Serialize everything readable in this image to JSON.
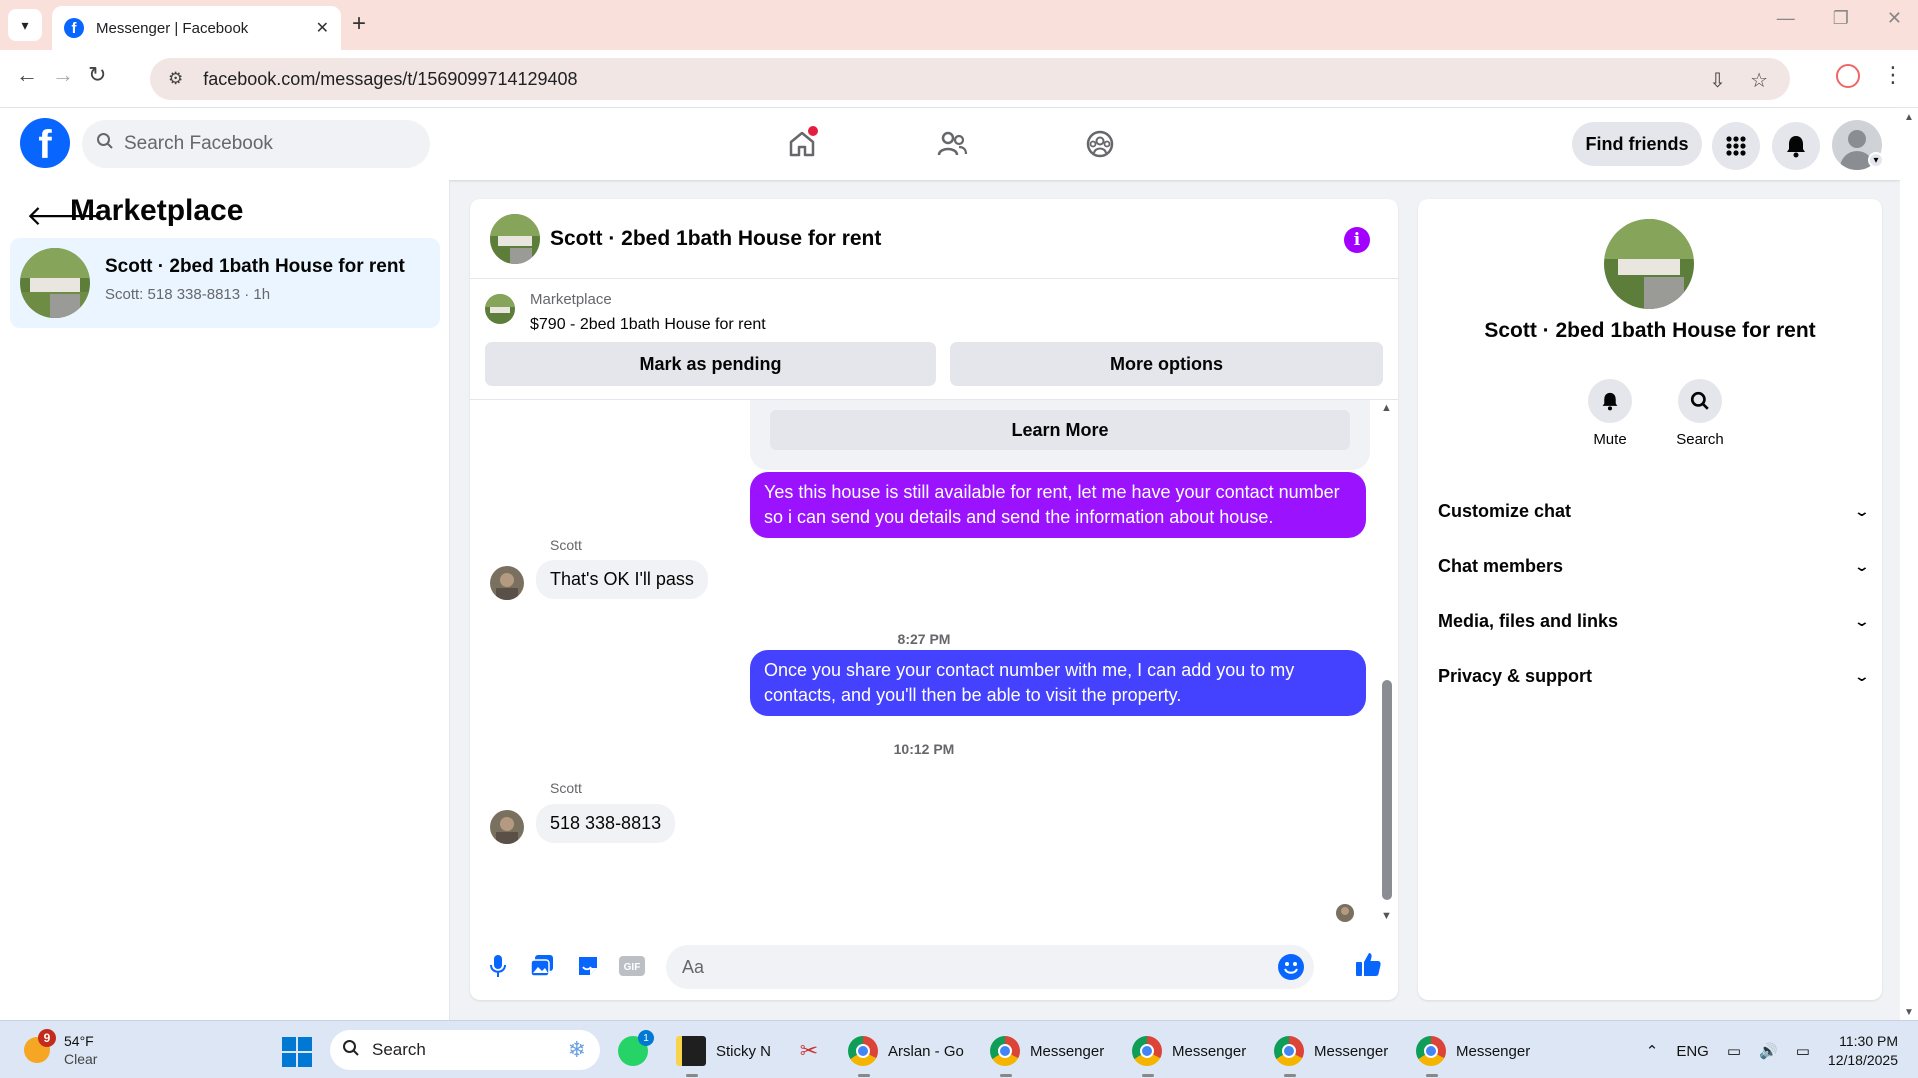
{
  "browser": {
    "tab_title": "Messenger | Facebook",
    "url": "facebook.com/messages/t/1569099714129408"
  },
  "fb_header": {
    "search_placeholder": "Search Facebook",
    "find_friends": "Find friends"
  },
  "sidebar": {
    "title": "Marketplace",
    "conversation": {
      "name": "Scott · 2bed 1bath House for rent",
      "preview": "Scott: 518 338-8813 · 1h"
    }
  },
  "chat": {
    "title": "Scott · 2bed 1bath House for rent",
    "listing": {
      "label": "Marketplace",
      "price_title": "$790 - 2bed 1bath House for rent",
      "mark_pending": "Mark as pending",
      "more_options": "More options"
    },
    "learn_more": "Learn More",
    "messages": [
      {
        "from": "me",
        "text": "Yes this house is still available for rent, let me have your contact number so i can send you details and send the information about house.",
        "color": "#9b12ff"
      },
      {
        "from": "Scott",
        "sender": "Scott",
        "text": "That's OK I'll pass"
      },
      {
        "time": "8:27 PM"
      },
      {
        "from": "me",
        "text": "Once you share your contact number with me, I can add you to my contacts, and you'll then be able to visit the property.",
        "color": "#4441ff"
      },
      {
        "time": "10:12 PM"
      },
      {
        "from": "Scott",
        "sender": "Scott",
        "text": "518 338-8813"
      }
    ],
    "composer_placeholder": "Aa"
  },
  "info_panel": {
    "name": "Scott · 2bed 1bath House for rent",
    "actions": [
      {
        "label": "Mute",
        "icon": "bell-icon"
      },
      {
        "label": "Search",
        "icon": "search-icon"
      }
    ],
    "sections": [
      "Customize chat",
      "Chat members",
      "Media, files and links",
      "Privacy & support"
    ]
  },
  "taskbar": {
    "weather_temp": "54°F",
    "weather_cond": "Clear",
    "weather_badge": "9",
    "search": "Search",
    "whatsapp_badge": "1",
    "apps": [
      {
        "label": "Sticky N"
      },
      {
        "label": "Arslan - Go"
      },
      {
        "label": "Messenger"
      },
      {
        "label": "Messenger"
      },
      {
        "label": "Messenger"
      },
      {
        "label": "Messenger"
      }
    ],
    "lang": "ENG",
    "time": "11:30 PM",
    "date": "12/18/2025"
  },
  "colors": {
    "accent": "#0866ff",
    "purple_bubble": "#9b12ff",
    "blue_bubble": "#4441ff",
    "info_purple": "#a200ff"
  }
}
